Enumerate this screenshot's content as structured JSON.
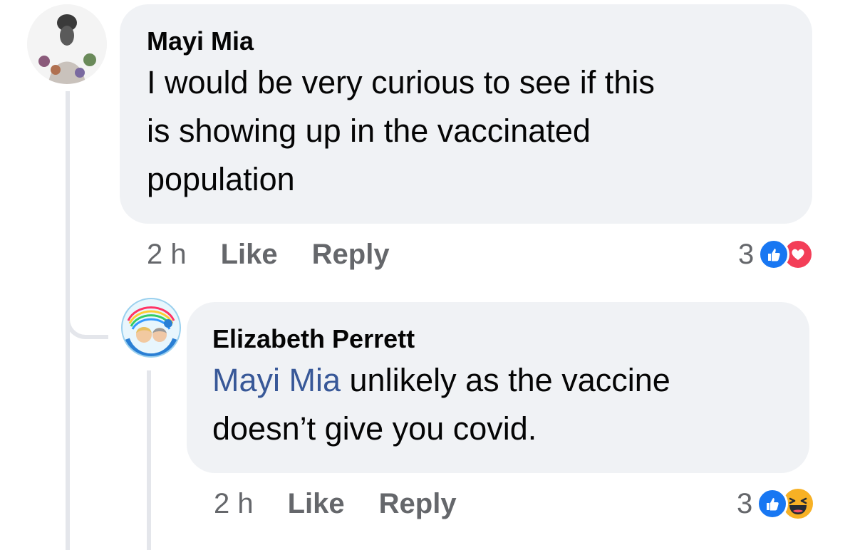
{
  "comments": [
    {
      "author": "Mayi Mia",
      "text": "I would be very curious to see if this is showing up in the vaccinated population",
      "lines": [
        "I would be very curious to see if this",
        "is showing up in the vaccinated",
        "population"
      ],
      "time": "2 h",
      "like_label": "Like",
      "reply_label": "Reply",
      "reaction_count": "3",
      "reaction_icons": [
        "like-icon",
        "love-icon"
      ]
    },
    {
      "author": "Elizabeth Perrett",
      "mention": "Mayi Mia",
      "line1_rest": " unlikely as the vaccine",
      "line2": "doesn’t give you covid.",
      "time": "2 h",
      "like_label": "Like",
      "reply_label": "Reply",
      "reaction_count": "3",
      "reaction_icons": [
        "like-icon",
        "haha-icon"
      ]
    }
  ],
  "colors": {
    "bubble": "#f0f2f5",
    "mention": "#385898",
    "meta_text": "#65676b",
    "like": "#1877f2",
    "love": "#f33e58",
    "haha": "#f7b125"
  }
}
